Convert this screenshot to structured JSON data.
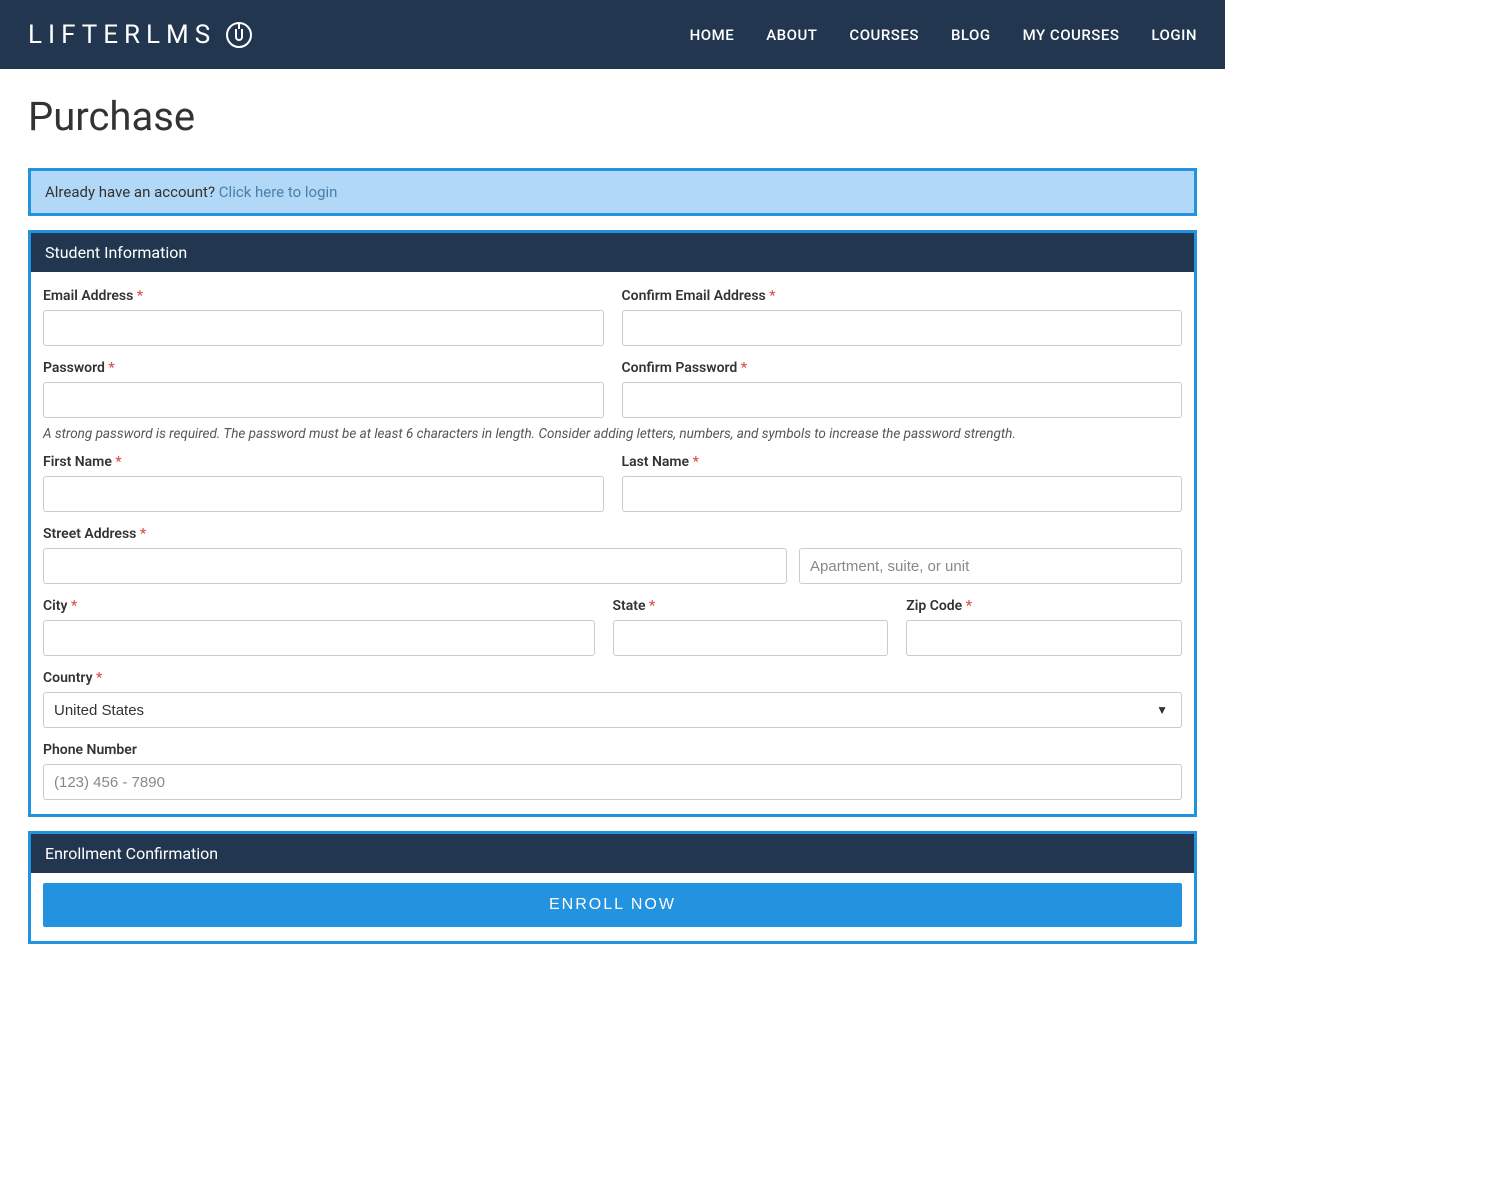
{
  "header": {
    "logo_text": "LIFTERLMS",
    "nav": {
      "home": "HOME",
      "about": "ABOUT",
      "courses": "COURSES",
      "blog": "BLOG",
      "my_courses": "MY COURSES",
      "login": "LOGIN"
    }
  },
  "page": {
    "title": "Purchase"
  },
  "notice": {
    "text": "Already have an account? ",
    "link_text": "Click here to login"
  },
  "student_info": {
    "section_title": "Student Information",
    "email_label": "Email Address",
    "confirm_email_label": "Confirm Email Address",
    "password_label": "Password",
    "confirm_password_label": "Confirm Password",
    "password_hint": "A strong password is required. The password must be at least 6 characters in length. Consider adding letters, numbers, and symbols to increase the password strength.",
    "first_name_label": "First Name",
    "last_name_label": "Last Name",
    "street_label": "Street Address",
    "apt_placeholder": "Apartment, suite, or unit",
    "city_label": "City",
    "state_label": "State",
    "zip_label": "Zip Code",
    "country_label": "Country",
    "country_value": "United States",
    "phone_label": "Phone Number",
    "phone_placeholder": "(123) 456 - 7890",
    "required_mark": "*"
  },
  "enrollment": {
    "section_title": "Enrollment Confirmation",
    "button_label": "ENROLL NOW"
  }
}
